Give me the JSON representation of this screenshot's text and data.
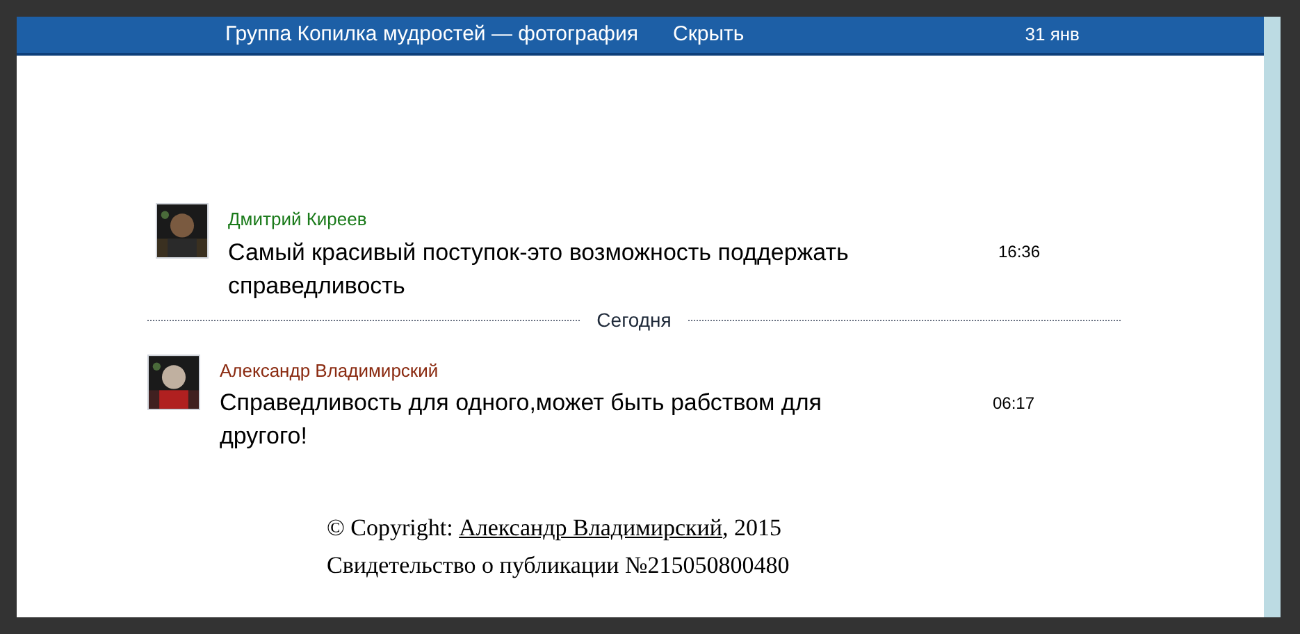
{
  "header": {
    "title": "Группа Копилка мудростей — фотография",
    "hide_link": "Скрыть",
    "date": "31 янв"
  },
  "messages": [
    {
      "author": "Дмитрий Киреев",
      "color": "#1a7a1a",
      "text": "Самый красивый поступок-это возможность поддержать справедливость",
      "time": "16:36"
    },
    {
      "kind": "divider",
      "label": "Сегодня"
    },
    {
      "author": "Александр Владимирский",
      "color": "#8a2a10",
      "text": "Справедливость для одного,может быть рабством для другого!",
      "time": "06:17"
    }
  ],
  "footer": {
    "copyright_prefix": "© Copyright: ",
    "copyright_link": "Александр Владимирский",
    "copyright_suffix": ", 2015",
    "certificate": "Свидетельство о публикации №215050800480"
  }
}
